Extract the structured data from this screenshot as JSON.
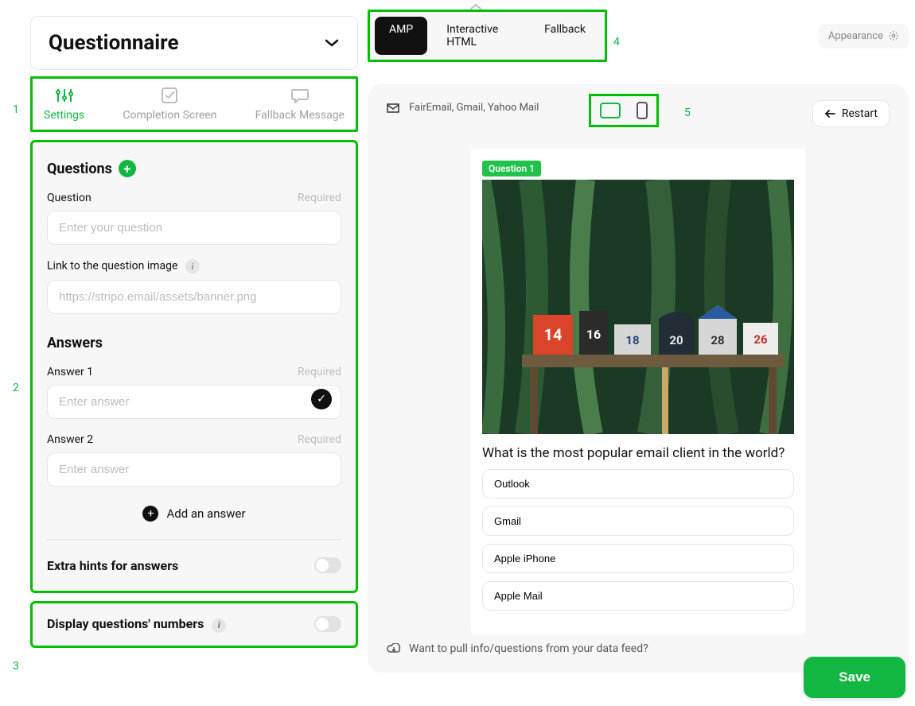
{
  "annotations": {
    "n1": "1",
    "n2": "2",
    "n3": "3",
    "n4": "4",
    "n5": "5"
  },
  "title": "Questionnaire",
  "tabs": {
    "settings": "Settings",
    "completion": "Completion Screen",
    "fallback": "Fallback Message"
  },
  "questions_section": {
    "heading": "Questions",
    "question_label": "Question",
    "required_label": "Required",
    "question_placeholder": "Enter your question",
    "image_label": "Link to the question image",
    "image_placeholder": "https://stripo.email/assets/banner.png"
  },
  "answers_section": {
    "heading": "Answers",
    "answer1_label": "Answer 1",
    "answer2_label": "Answer 2",
    "required_label": "Required",
    "answer_placeholder": "Enter answer",
    "add_answer": "Add an answer",
    "extra_hints": "Extra hints for answers"
  },
  "display_numbers": "Display questions' numbers",
  "view_modes": {
    "amp": "AMP",
    "interactive": "Interactive HTML",
    "fallback": "Fallback"
  },
  "appearance": "Appearance",
  "clients_label": "FairEmail, Gmail, Yahoo Mail",
  "restart": "Restart",
  "preview": {
    "badge": "Question 1",
    "question": "What is the most popular email client in the world?",
    "answers": [
      "Outlook",
      "Gmail",
      "Apple iPhone",
      "Apple Mail"
    ]
  },
  "feed_prompt": "Want to pull info/questions from your data feed?",
  "save": "Save"
}
